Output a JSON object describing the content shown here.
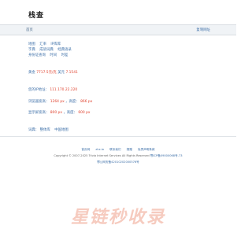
{
  "header": {
    "logo_text": "栈查"
  },
  "navbar": {
    "home": "首页",
    "copy_address": "复制网址"
  },
  "links_row1": [
    "地图",
    "汇率",
    "IP库库"
  ],
  "links_row2": [
    "字典",
    "成语词典",
    "经典语录"
  ],
  "links_row3": [
    "身份证查询",
    "时间",
    "时差"
  ],
  "weather": {
    "prefix": "黄金",
    "value": "7717.5元/克",
    "suffix": "美元",
    "value2": "7.1541"
  },
  "ip": {
    "label": "您的IP地址：",
    "value": "111.170.22.220"
  },
  "resolution": {
    "label": "浏览器宽高：",
    "width": "1264 px",
    "sep": "，高度：",
    "height": "866 px"
  },
  "screen": {
    "label": "显示屏宽高：",
    "width": "800 px",
    "sep": "，高度：",
    "height": "600 px"
  },
  "extra": {
    "label": "词典：",
    "link1": "整体库",
    "link2": "中国地图"
  },
  "footer": {
    "links": [
      "首页网",
      "zhx.io",
      "联系我们",
      "捐赠",
      "免责声明条款"
    ],
    "copyright": "Copyright © 2007-2025   Trivia Internet Services   All Rights Reserved",
    "icp": "鄂ICP备09000068号-73",
    "police": "鄂公网安备42010202000576号"
  },
  "watermark": "星链秒收录"
}
